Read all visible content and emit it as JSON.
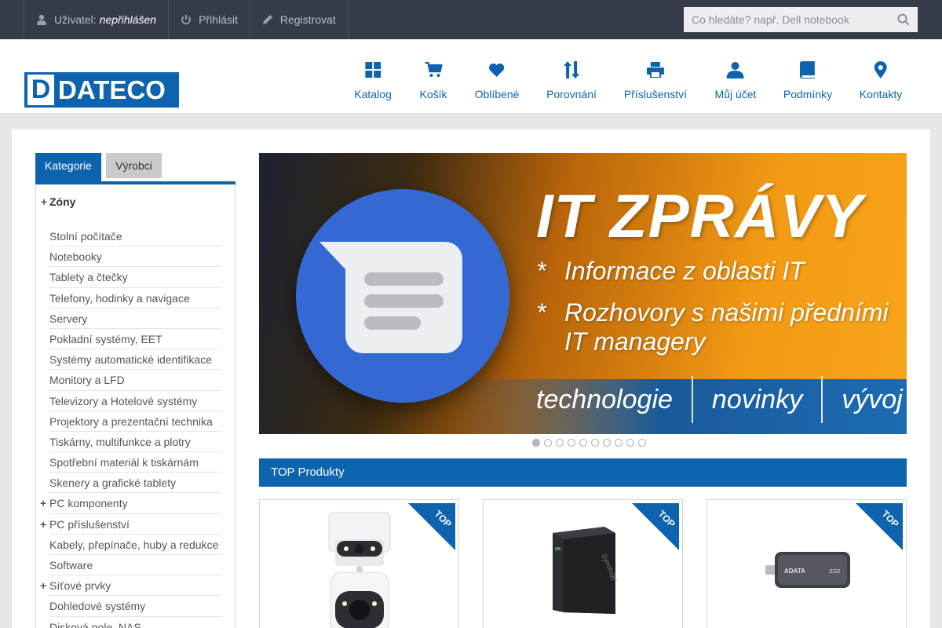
{
  "topbar": {
    "user_label": "Uživatel:",
    "user_value": "nepřihlášen",
    "login": "Přihlásit",
    "register": "Registrovat",
    "search_placeholder": "Co hledáte? např. Dell notebook"
  },
  "logo": {
    "letter": "D",
    "text": "DATECO"
  },
  "nav": [
    {
      "label": "Katalog",
      "icon": "grid-icon"
    },
    {
      "label": "Košík",
      "icon": "cart-icon"
    },
    {
      "label": "Oblíbené",
      "icon": "heart-icon"
    },
    {
      "label": "Porovnání",
      "icon": "sort-arrows-icon"
    },
    {
      "label": "Příslušenství",
      "icon": "printer-icon"
    },
    {
      "label": "Můj účet",
      "icon": "user-icon"
    },
    {
      "label": "Podmínky",
      "icon": "book-icon"
    },
    {
      "label": "Kontakty",
      "icon": "map-pin-icon"
    }
  ],
  "sidebar": {
    "tabs": [
      "Kategorie",
      "Výrobci"
    ],
    "zones": "Zóny",
    "categories": [
      {
        "label": "Stolní počítače",
        "expandable": false
      },
      {
        "label": "Notebooky",
        "expandable": false
      },
      {
        "label": "Tablety a čtečky",
        "expandable": false
      },
      {
        "label": "Telefony, hodinky a navigace",
        "expandable": false
      },
      {
        "label": "Servery",
        "expandable": false
      },
      {
        "label": "Pokladní systémy, EET",
        "expandable": false
      },
      {
        "label": "Systémy automatické identifikace",
        "expandable": false
      },
      {
        "label": "Monitory a LFD",
        "expandable": false
      },
      {
        "label": "Televizory a Hotelové systémy",
        "expandable": false
      },
      {
        "label": "Projektory a prezentační technika",
        "expandable": false
      },
      {
        "label": "Tiskárny, multifunkce a plotry",
        "expandable": false
      },
      {
        "label": "Spotřební materiál k tiskárnám",
        "expandable": false
      },
      {
        "label": "Skenery a grafické tablety",
        "expandable": false
      },
      {
        "label": "PC komponenty",
        "expandable": true
      },
      {
        "label": "PC příslušenství",
        "expandable": true
      },
      {
        "label": "Kabely, přepínače, huby a redukce",
        "expandable": false
      },
      {
        "label": "Software",
        "expandable": false
      },
      {
        "label": "Síťové prvky",
        "expandable": true
      },
      {
        "label": "Dohledové systémy",
        "expandable": false
      },
      {
        "label": "Disková pole, NAS",
        "expandable": false
      }
    ]
  },
  "banner": {
    "headline": "IT ZPRÁVY",
    "bullet1": "Informace z oblasti IT",
    "bullet2a": "Rozhovory s našimi předními",
    "bullet2b": "IT managery",
    "star": "*",
    "tag1": "technologie",
    "tag2": "novinky",
    "tag3": "vývoj",
    "slides_total": 10,
    "slide_active": 1
  },
  "top_products": {
    "title": "TOP Produkty",
    "badge": "TOP",
    "items": [
      {
        "image": "camera-image"
      },
      {
        "image": "nas-image"
      },
      {
        "image": "ssd-image"
      }
    ]
  },
  "colors": {
    "brand": "#0d63ad",
    "topbar": "#353b48",
    "background": "#e5e7ea"
  }
}
